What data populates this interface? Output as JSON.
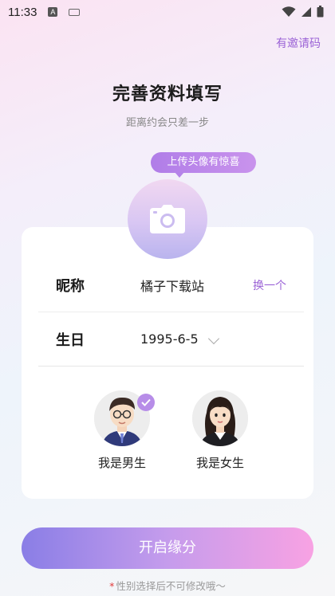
{
  "status_bar": {
    "time": "11:33",
    "icons": [
      "notification-a-icon",
      "keyboard-icon",
      "wifi-icon",
      "signal-icon",
      "battery-icon"
    ],
    "notification_glyph": "A"
  },
  "header": {
    "invite_link": "有邀请码",
    "title": "完善资料填写",
    "subtitle": "距离约会只差一步"
  },
  "avatar_upload": {
    "tip": "上传头像有惊喜",
    "icon": "camera-icon"
  },
  "form": {
    "nickname_label": "昵称",
    "nickname_value": "橘子下载站",
    "change_label": "换一个",
    "birthday_label": "生日",
    "birthday_value": "1995-6-5"
  },
  "gender": {
    "male_label": "我是男生",
    "female_label": "我是女生",
    "selected": "male"
  },
  "actions": {
    "start_label": "开启缘分",
    "notice_star": "*",
    "notice_text": "性别选择后不可修改哦～"
  },
  "colors": {
    "accent": "#9b63d6",
    "button_gradient_start": "#8a7ee6",
    "button_gradient_end": "#f8a2e3"
  }
}
